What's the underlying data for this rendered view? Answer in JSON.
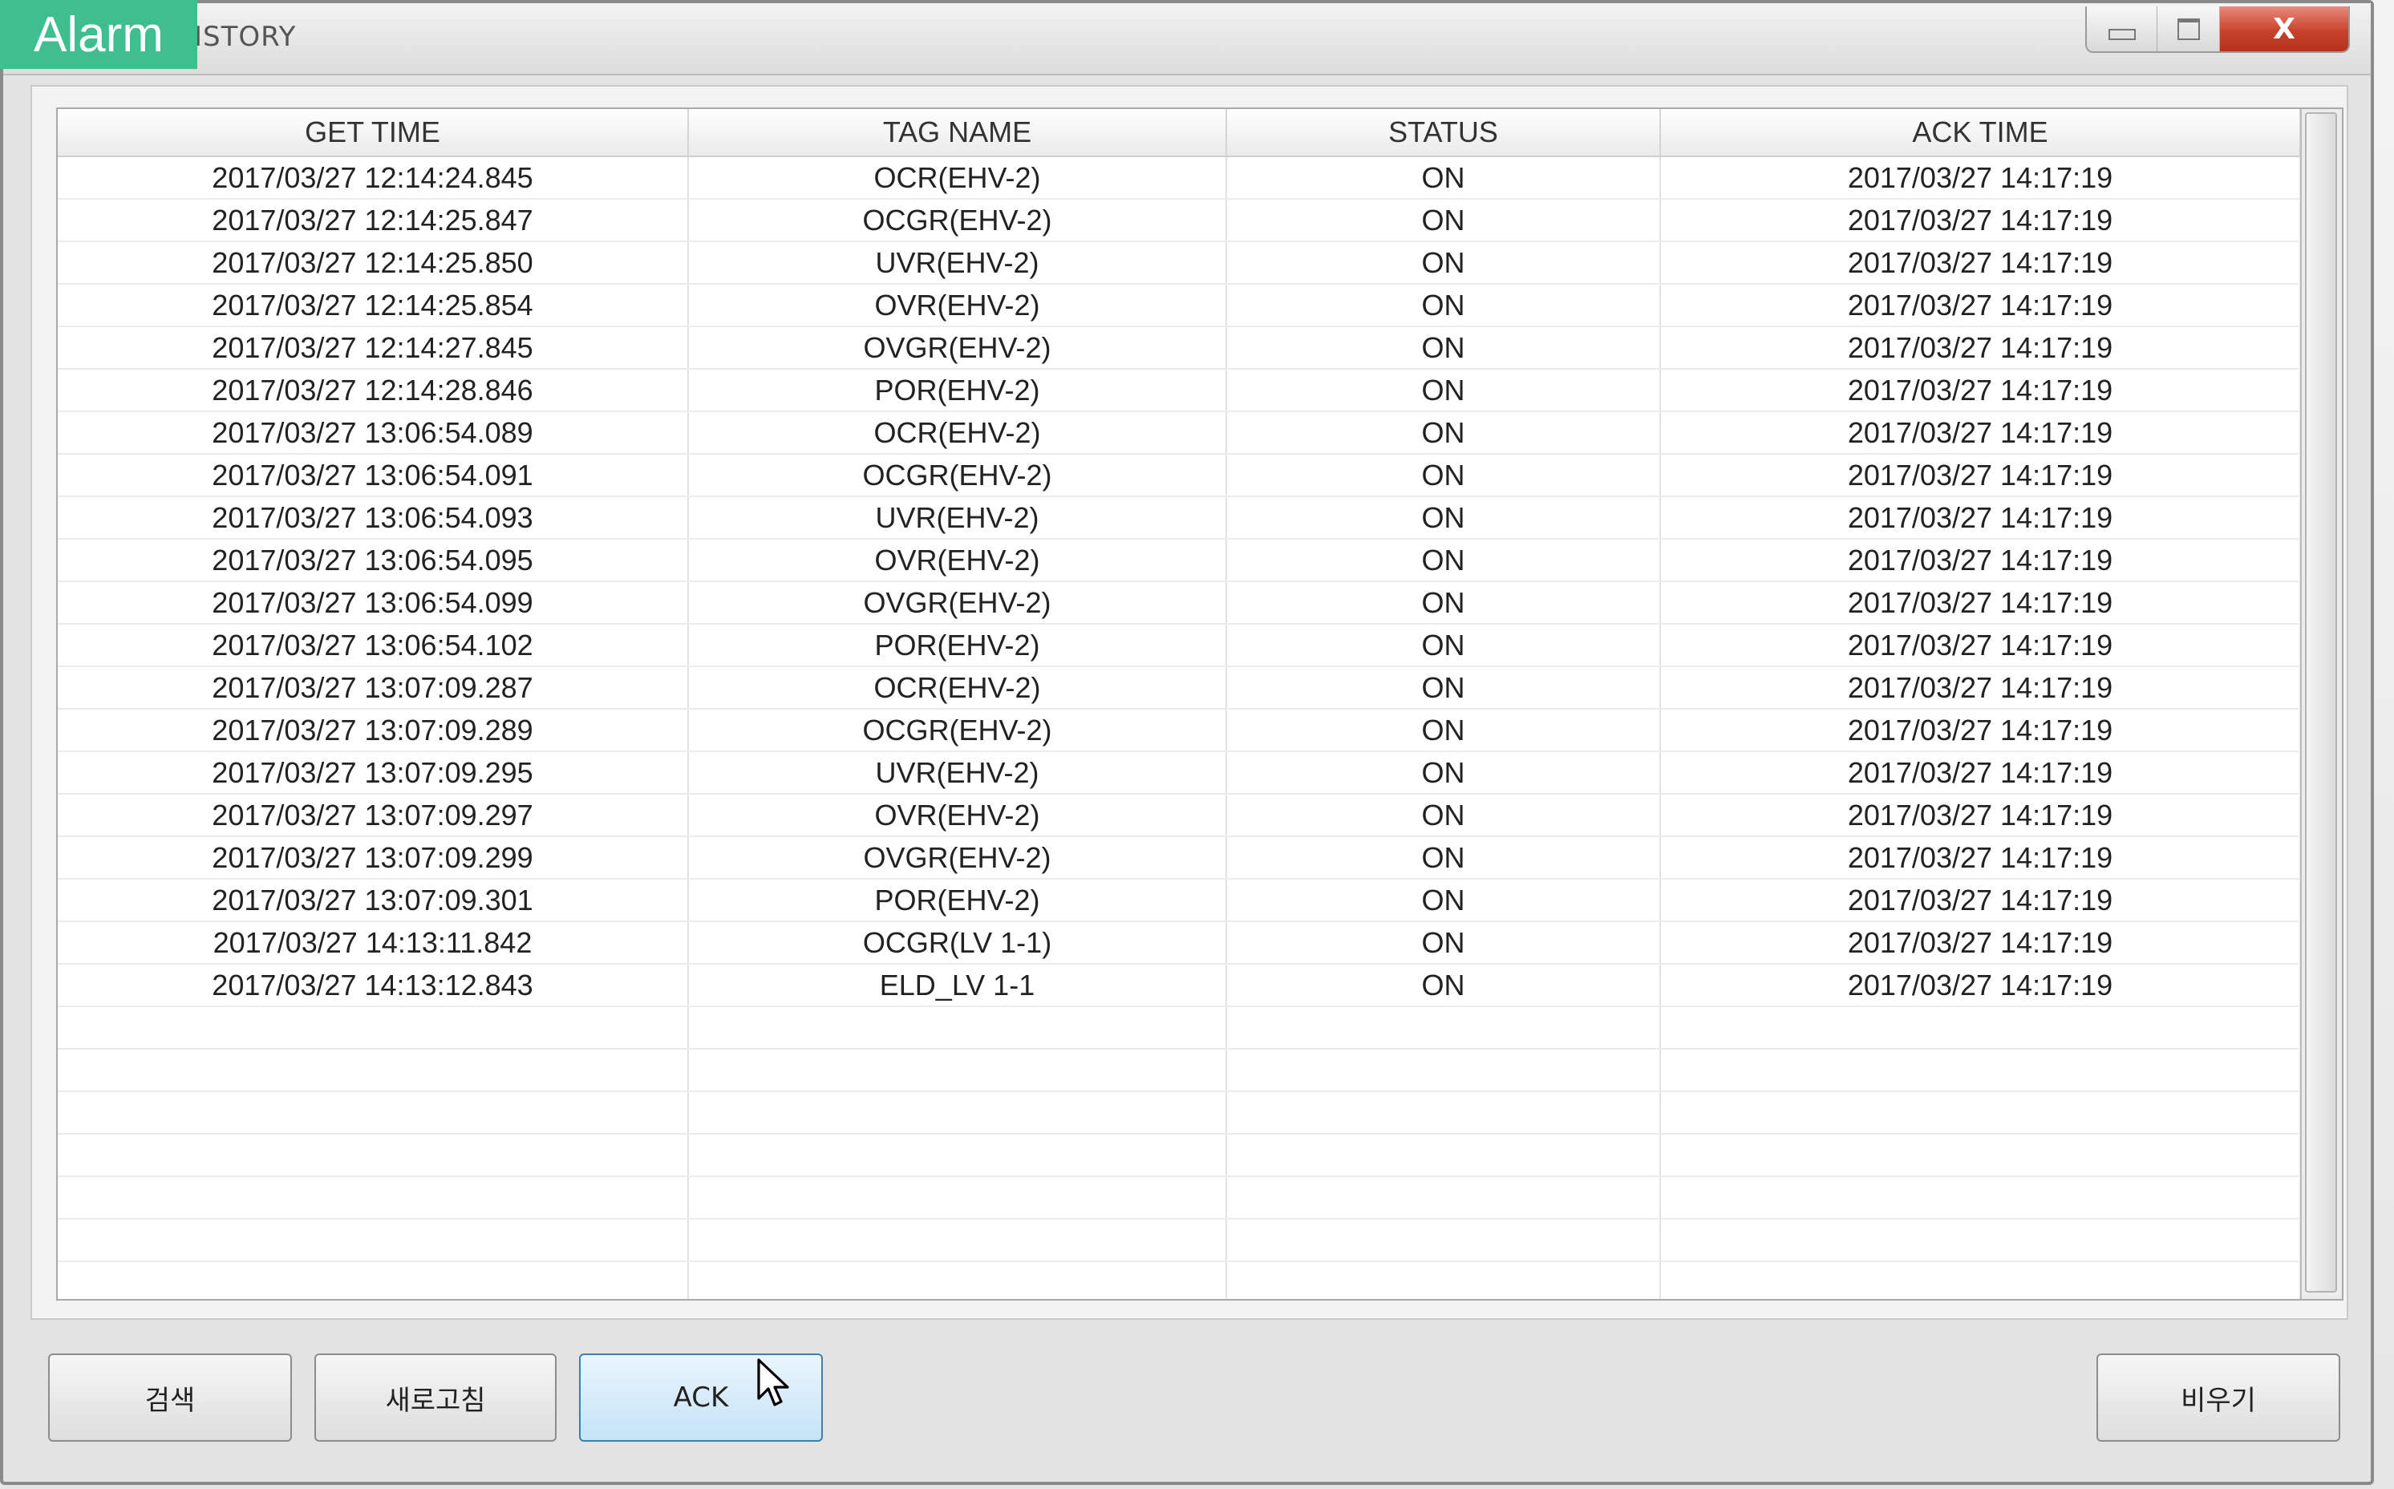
{
  "app_badge": "Alarm",
  "window": {
    "title": "ISTORY",
    "controls": {
      "minimize_icon": "minimize-icon",
      "maximize_icon": "maximize-icon",
      "close_label": "X"
    }
  },
  "table": {
    "columns": [
      "GET TIME",
      "TAG NAME",
      "STATUS",
      "ACK TIME"
    ],
    "rows": [
      [
        "2017/03/27 12:14:24.845",
        "OCR(EHV-2)",
        "ON",
        "2017/03/27 14:17:19"
      ],
      [
        "2017/03/27 12:14:25.847",
        "OCGR(EHV-2)",
        "ON",
        "2017/03/27 14:17:19"
      ],
      [
        "2017/03/27 12:14:25.850",
        "UVR(EHV-2)",
        "ON",
        "2017/03/27 14:17:19"
      ],
      [
        "2017/03/27 12:14:25.854",
        "OVR(EHV-2)",
        "ON",
        "2017/03/27 14:17:19"
      ],
      [
        "2017/03/27 12:14:27.845",
        "OVGR(EHV-2)",
        "ON",
        "2017/03/27 14:17:19"
      ],
      [
        "2017/03/27 12:14:28.846",
        "POR(EHV-2)",
        "ON",
        "2017/03/27 14:17:19"
      ],
      [
        "2017/03/27 13:06:54.089",
        "OCR(EHV-2)",
        "ON",
        "2017/03/27 14:17:19"
      ],
      [
        "2017/03/27 13:06:54.091",
        "OCGR(EHV-2)",
        "ON",
        "2017/03/27 14:17:19"
      ],
      [
        "2017/03/27 13:06:54.093",
        "UVR(EHV-2)",
        "ON",
        "2017/03/27 14:17:19"
      ],
      [
        "2017/03/27 13:06:54.095",
        "OVR(EHV-2)",
        "ON",
        "2017/03/27 14:17:19"
      ],
      [
        "2017/03/27 13:06:54.099",
        "OVGR(EHV-2)",
        "ON",
        "2017/03/27 14:17:19"
      ],
      [
        "2017/03/27 13:06:54.102",
        "POR(EHV-2)",
        "ON",
        "2017/03/27 14:17:19"
      ],
      [
        "2017/03/27 13:07:09.287",
        "OCR(EHV-2)",
        "ON",
        "2017/03/27 14:17:19"
      ],
      [
        "2017/03/27 13:07:09.289",
        "OCGR(EHV-2)",
        "ON",
        "2017/03/27 14:17:19"
      ],
      [
        "2017/03/27 13:07:09.295",
        "UVR(EHV-2)",
        "ON",
        "2017/03/27 14:17:19"
      ],
      [
        "2017/03/27 13:07:09.297",
        "OVR(EHV-2)",
        "ON",
        "2017/03/27 14:17:19"
      ],
      [
        "2017/03/27 13:07:09.299",
        "OVGR(EHV-2)",
        "ON",
        "2017/03/27 14:17:19"
      ],
      [
        "2017/03/27 13:07:09.301",
        "POR(EHV-2)",
        "ON",
        "2017/03/27 14:17:19"
      ],
      [
        "2017/03/27 14:13:11.842",
        "OCGR(LV 1-1)",
        "ON",
        "2017/03/27 14:17:19"
      ],
      [
        "2017/03/27 14:13:12.843",
        "ELD_LV 1-1",
        "ON",
        "2017/03/27 14:17:19"
      ]
    ]
  },
  "buttons": {
    "search": "검색",
    "refresh": "새로고침",
    "ack": "ACK",
    "clear": "비우기"
  }
}
